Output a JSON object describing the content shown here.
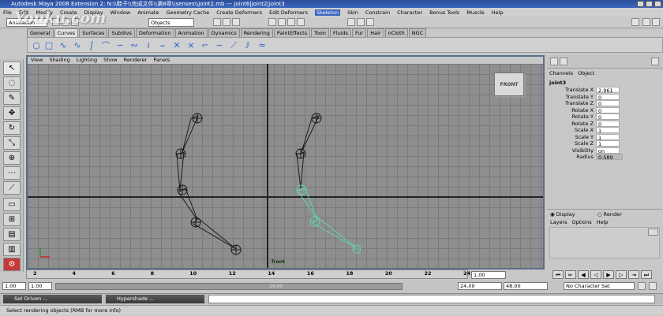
{
  "title": "Autodesk Maya 2008 Extension 2: N:\\\\鞋子\\\\完成文件\\\\第8章\\\\senses\\\\joint2.mb  ---  joint6|joint2|joint3",
  "watermark": "Youku.com",
  "menu": [
    "File",
    "Edit",
    "Modify",
    "Create",
    "Display",
    "Window",
    "Animate",
    "Geometry Cache",
    "Create Deformers",
    "Edit Deformers",
    "Skeleton",
    "Skin",
    "Constrain",
    "Character",
    "Bonus Tools",
    "Muscle",
    "Help"
  ],
  "menu_active": "Skeleton",
  "status": {
    "mode": "Animation",
    "selection_mask": "Objects"
  },
  "shelf_tabs": [
    "General",
    "Curves",
    "Surfaces",
    "Subdivs",
    "Deformation",
    "Animation",
    "Dynamics",
    "Rendering",
    "PaintEffects",
    "Toon",
    "Fluids",
    "Fur",
    "Hair",
    "nCloth",
    "NGC"
  ],
  "shelf_tab_active": "Curves",
  "panel_menu": [
    "View",
    "Shading",
    "Lighting",
    "Show",
    "Renderer",
    "Panels"
  ],
  "viewcube_label": "FRONT",
  "camera_label": "front",
  "channel_box": {
    "menu": [
      "Channels",
      "Object"
    ],
    "node": "joint3",
    "attributes": [
      {
        "label": "Translate X",
        "value": "2.961"
      },
      {
        "label": "Translate Y",
        "value": "0"
      },
      {
        "label": "Translate Z",
        "value": "0"
      },
      {
        "label": "Rotate X",
        "value": "0"
      },
      {
        "label": "Rotate Y",
        "value": "0"
      },
      {
        "label": "Rotate Z",
        "value": "0"
      },
      {
        "label": "Scale X",
        "value": "1"
      },
      {
        "label": "Scale Y",
        "value": "1"
      },
      {
        "label": "Scale Z",
        "value": "1"
      },
      {
        "label": "Visibility",
        "value": "on"
      },
      {
        "label": "Radius",
        "value": "0.589"
      }
    ]
  },
  "layer_editor": {
    "display_label": "Display",
    "render_label": "Render",
    "menu": [
      "Layers",
      "Options",
      "Help"
    ]
  },
  "timeline": {
    "ticks": [
      "2",
      "4",
      "6",
      "8",
      "10",
      "12",
      "14",
      "16",
      "18",
      "20",
      "22",
      "24"
    ],
    "current_frame": "1.00"
  },
  "range": {
    "start": "1.00",
    "inner_start": "1.00",
    "playback_end": "24.00",
    "end": "48.00",
    "current_value": "24.00"
  },
  "character_set": "No Character Set",
  "taskbar": [
    {
      "label": "Set Driven ..."
    },
    {
      "label": "Hypershade ..."
    }
  ],
  "help_line": "Select rendering objects (RMB for more info)",
  "colors": {
    "selected_joint": "#5fd8a8",
    "joint": "#111111",
    "title_bar": "#3c66c0"
  }
}
